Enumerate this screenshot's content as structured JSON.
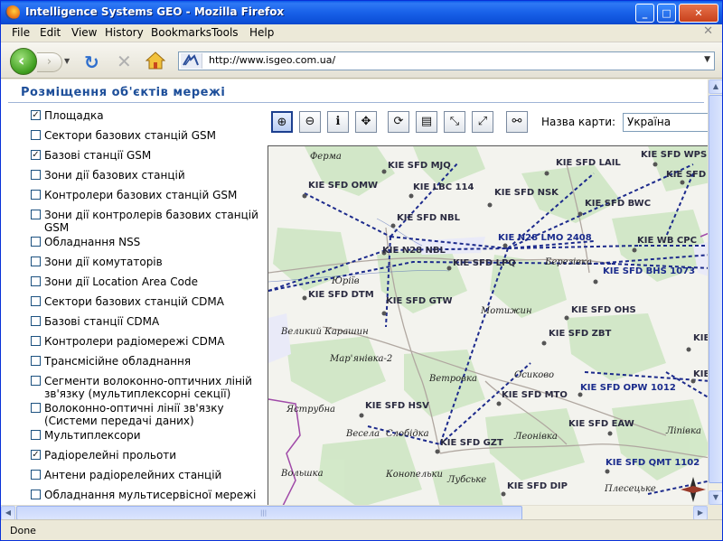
{
  "window": {
    "title": "Intelligence Systems GEO - Mozilla Firefox",
    "min": "_",
    "max": "□",
    "close": "✕"
  },
  "menu": [
    "File",
    "Edit",
    "View",
    "History",
    "Bookmarks",
    "Tools",
    "Help"
  ],
  "address": {
    "url": "http://www.isgeo.com.ua/"
  },
  "status": "Done",
  "page": {
    "title": "Розміщення об'єктів мережі",
    "map_label": "Назва карти:",
    "map_value": "Україна"
  },
  "layers": [
    {
      "label": "Площадка",
      "checked": true
    },
    {
      "label": "Сектори базових станцій GSM",
      "checked": false
    },
    {
      "label": "Базові станції GSM",
      "checked": true
    },
    {
      "label": "Зони дії базових станцій",
      "checked": false
    },
    {
      "label": "Контролери базових станцій GSM",
      "checked": false
    },
    {
      "label": "Зони дії контролерів базових станцій GSM",
      "checked": false
    },
    {
      "label": "Обладнання NSS",
      "checked": false
    },
    {
      "label": "Зони дії комутаторів",
      "checked": false
    },
    {
      "label": "Зони дії Location Area Code",
      "checked": false
    },
    {
      "label": "Сектори базових станцій CDMA",
      "checked": false
    },
    {
      "label": "Базові станції CDMA",
      "checked": false
    },
    {
      "label": "Контролери радіомережі CDMA",
      "checked": false
    },
    {
      "label": "Трансмісійне обладнання",
      "checked": false
    },
    {
      "label": "Сегменти волоконно-оптичних ліній зв'язку (мультиплексорні секції)",
      "checked": false
    },
    {
      "label": "Волоконно-оптичні лінії зв'язку (Системи передачі даних)",
      "checked": false
    },
    {
      "label": "Мультиплексори",
      "checked": false
    },
    {
      "label": "Радіорелейні прольоти",
      "checked": true
    },
    {
      "label": "Антени радіорелейних станцій",
      "checked": false
    },
    {
      "label": "Обладнання мультисервісної мережі",
      "checked": false
    }
  ],
  "tools": [
    {
      "name": "zoom-in",
      "glyph": "⊕",
      "selected": true
    },
    {
      "name": "zoom-out",
      "glyph": "⊖",
      "selected": false
    },
    {
      "name": "info",
      "glyph": "ℹ",
      "selected": false
    },
    {
      "name": "pan",
      "glyph": "✥",
      "selected": false
    },
    {
      "name": "refresh",
      "glyph": "⟳",
      "selected": false
    },
    {
      "name": "layers",
      "glyph": "▤",
      "selected": false
    },
    {
      "name": "shrink",
      "glyph": "⤡",
      "selected": false
    },
    {
      "name": "full-extent",
      "glyph": "⤢",
      "selected": false
    },
    {
      "name": "find",
      "glyph": "⚯",
      "selected": false
    }
  ],
  "map": {
    "towns": [
      "Ферма",
      "Юріїв",
      "Березівка",
      "Мотижин",
      "Великий Карашин",
      "Мар'янівка-2",
      "Ветровка",
      "Осиково",
      "Яструбна",
      "Весела",
      "Слобідка",
      "Леонівка",
      "Ліпівка",
      "Вольшка",
      "Конопельки",
      "Лубське",
      "Плесецьке"
    ],
    "stations": [
      "KIE SFD MJQ",
      "KIE SFD LAIL",
      "KIE SFD WPS",
      "KIE SFD OMW",
      "KIE LBC 114",
      "KIE SFD NSK",
      "KIE SFD ACD",
      "KIE SFD NBL",
      "KIE SFD BWC",
      "KIE N28 LMO 2408",
      "KIE N28 NBL",
      "KIE WB CPC",
      "KIE SFD LPQ",
      "KIE SFD BHS 1073",
      "KIE SFD DTM",
      "KIE SFD GTW",
      "KIE SFD OHS",
      "KIE SFD ZBT",
      "KIE SFD C",
      "KIE SFD OPW 1012",
      "KIE SF",
      "KIE SFD MTO",
      "KIE SFD HSV",
      "KIE SFD EAW",
      "KIE SFD GZT",
      "KIE SFD QMT 1102",
      "KIE SFD DIP"
    ]
  }
}
